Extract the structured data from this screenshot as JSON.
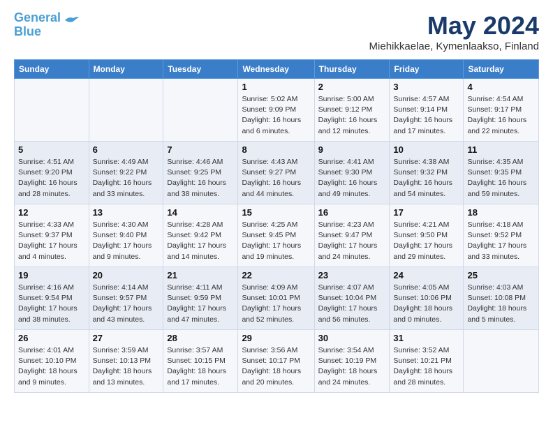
{
  "logo": {
    "line1": "General",
    "line2": "Blue"
  },
  "title": "May 2024",
  "location": "Miehikkaelae, Kymenlaakso, Finland",
  "days_of_week": [
    "Sunday",
    "Monday",
    "Tuesday",
    "Wednesday",
    "Thursday",
    "Friday",
    "Saturday"
  ],
  "weeks": [
    [
      {
        "day": "",
        "info": ""
      },
      {
        "day": "",
        "info": ""
      },
      {
        "day": "",
        "info": ""
      },
      {
        "day": "1",
        "info": "Sunrise: 5:02 AM\nSunset: 9:09 PM\nDaylight: 16 hours\nand 6 minutes."
      },
      {
        "day": "2",
        "info": "Sunrise: 5:00 AM\nSunset: 9:12 PM\nDaylight: 16 hours\nand 12 minutes."
      },
      {
        "day": "3",
        "info": "Sunrise: 4:57 AM\nSunset: 9:14 PM\nDaylight: 16 hours\nand 17 minutes."
      },
      {
        "day": "4",
        "info": "Sunrise: 4:54 AM\nSunset: 9:17 PM\nDaylight: 16 hours\nand 22 minutes."
      }
    ],
    [
      {
        "day": "5",
        "info": "Sunrise: 4:51 AM\nSunset: 9:20 PM\nDaylight: 16 hours\nand 28 minutes."
      },
      {
        "day": "6",
        "info": "Sunrise: 4:49 AM\nSunset: 9:22 PM\nDaylight: 16 hours\nand 33 minutes."
      },
      {
        "day": "7",
        "info": "Sunrise: 4:46 AM\nSunset: 9:25 PM\nDaylight: 16 hours\nand 38 minutes."
      },
      {
        "day": "8",
        "info": "Sunrise: 4:43 AM\nSunset: 9:27 PM\nDaylight: 16 hours\nand 44 minutes."
      },
      {
        "day": "9",
        "info": "Sunrise: 4:41 AM\nSunset: 9:30 PM\nDaylight: 16 hours\nand 49 minutes."
      },
      {
        "day": "10",
        "info": "Sunrise: 4:38 AM\nSunset: 9:32 PM\nDaylight: 16 hours\nand 54 minutes."
      },
      {
        "day": "11",
        "info": "Sunrise: 4:35 AM\nSunset: 9:35 PM\nDaylight: 16 hours\nand 59 minutes."
      }
    ],
    [
      {
        "day": "12",
        "info": "Sunrise: 4:33 AM\nSunset: 9:37 PM\nDaylight: 17 hours\nand 4 minutes."
      },
      {
        "day": "13",
        "info": "Sunrise: 4:30 AM\nSunset: 9:40 PM\nDaylight: 17 hours\nand 9 minutes."
      },
      {
        "day": "14",
        "info": "Sunrise: 4:28 AM\nSunset: 9:42 PM\nDaylight: 17 hours\nand 14 minutes."
      },
      {
        "day": "15",
        "info": "Sunrise: 4:25 AM\nSunset: 9:45 PM\nDaylight: 17 hours\nand 19 minutes."
      },
      {
        "day": "16",
        "info": "Sunrise: 4:23 AM\nSunset: 9:47 PM\nDaylight: 17 hours\nand 24 minutes."
      },
      {
        "day": "17",
        "info": "Sunrise: 4:21 AM\nSunset: 9:50 PM\nDaylight: 17 hours\nand 29 minutes."
      },
      {
        "day": "18",
        "info": "Sunrise: 4:18 AM\nSunset: 9:52 PM\nDaylight: 17 hours\nand 33 minutes."
      }
    ],
    [
      {
        "day": "19",
        "info": "Sunrise: 4:16 AM\nSunset: 9:54 PM\nDaylight: 17 hours\nand 38 minutes."
      },
      {
        "day": "20",
        "info": "Sunrise: 4:14 AM\nSunset: 9:57 PM\nDaylight: 17 hours\nand 43 minutes."
      },
      {
        "day": "21",
        "info": "Sunrise: 4:11 AM\nSunset: 9:59 PM\nDaylight: 17 hours\nand 47 minutes."
      },
      {
        "day": "22",
        "info": "Sunrise: 4:09 AM\nSunset: 10:01 PM\nDaylight: 17 hours\nand 52 minutes."
      },
      {
        "day": "23",
        "info": "Sunrise: 4:07 AM\nSunset: 10:04 PM\nDaylight: 17 hours\nand 56 minutes."
      },
      {
        "day": "24",
        "info": "Sunrise: 4:05 AM\nSunset: 10:06 PM\nDaylight: 18 hours\nand 0 minutes."
      },
      {
        "day": "25",
        "info": "Sunrise: 4:03 AM\nSunset: 10:08 PM\nDaylight: 18 hours\nand 5 minutes."
      }
    ],
    [
      {
        "day": "26",
        "info": "Sunrise: 4:01 AM\nSunset: 10:10 PM\nDaylight: 18 hours\nand 9 minutes."
      },
      {
        "day": "27",
        "info": "Sunrise: 3:59 AM\nSunset: 10:13 PM\nDaylight: 18 hours\nand 13 minutes."
      },
      {
        "day": "28",
        "info": "Sunrise: 3:57 AM\nSunset: 10:15 PM\nDaylight: 18 hours\nand 17 minutes."
      },
      {
        "day": "29",
        "info": "Sunrise: 3:56 AM\nSunset: 10:17 PM\nDaylight: 18 hours\nand 20 minutes."
      },
      {
        "day": "30",
        "info": "Sunrise: 3:54 AM\nSunset: 10:19 PM\nDaylight: 18 hours\nand 24 minutes."
      },
      {
        "day": "31",
        "info": "Sunrise: 3:52 AM\nSunset: 10:21 PM\nDaylight: 18 hours\nand 28 minutes."
      },
      {
        "day": "",
        "info": ""
      }
    ]
  ]
}
